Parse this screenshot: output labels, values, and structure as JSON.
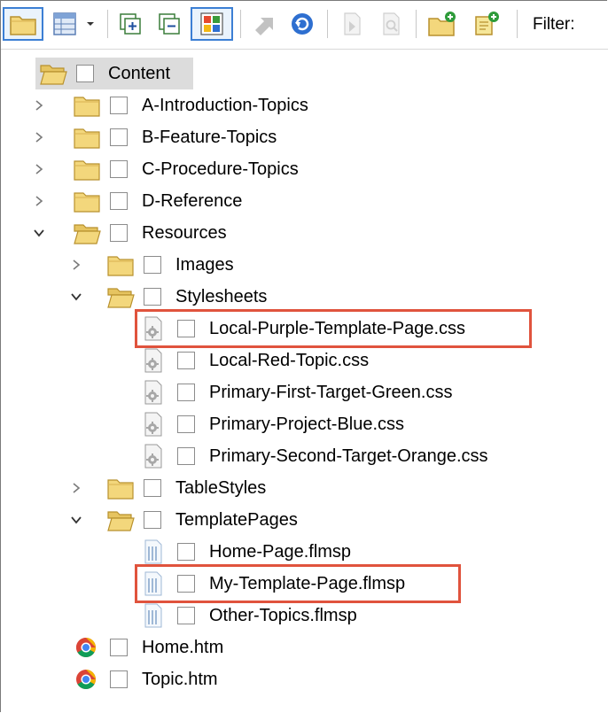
{
  "toolbar": {
    "filter_label": "Filter:"
  },
  "tree": {
    "root": {
      "label": "Content",
      "icon": "folder-open-icon"
    },
    "items": [
      {
        "label": "A-Introduction-Topics",
        "icon": "folder-icon",
        "state": "collapsed"
      },
      {
        "label": "B-Feature-Topics",
        "icon": "folder-icon",
        "state": "collapsed"
      },
      {
        "label": "C-Procedure-Topics",
        "icon": "folder-icon",
        "state": "collapsed"
      },
      {
        "label": "D-Reference",
        "icon": "folder-icon",
        "state": "collapsed"
      },
      {
        "label": "Resources",
        "icon": "folder-open-icon",
        "state": "expanded"
      },
      {
        "label": "Images",
        "icon": "folder-icon",
        "state": "collapsed"
      },
      {
        "label": "Stylesheets",
        "icon": "folder-open-icon",
        "state": "expanded"
      },
      {
        "label": "Local-Purple-Template-Page.css",
        "icon": "stylesheet-file-icon",
        "highlighted": true
      },
      {
        "label": "Local-Red-Topic.css",
        "icon": "stylesheet-file-icon"
      },
      {
        "label": "Primary-First-Target-Green.css",
        "icon": "stylesheet-file-icon"
      },
      {
        "label": "Primary-Project-Blue.css",
        "icon": "stylesheet-file-icon"
      },
      {
        "label": "Primary-Second-Target-Orange.css",
        "icon": "stylesheet-file-icon"
      },
      {
        "label": "TableStyles",
        "icon": "folder-icon",
        "state": "collapsed"
      },
      {
        "label": "TemplatePages",
        "icon": "folder-open-icon",
        "state": "expanded"
      },
      {
        "label": "Home-Page.flmsp",
        "icon": "template-page-file-icon"
      },
      {
        "label": "My-Template-Page.flmsp",
        "icon": "template-page-file-icon",
        "highlighted": true
      },
      {
        "label": "Other-Topics.flmsp",
        "icon": "template-page-file-icon"
      },
      {
        "label": "Home.htm",
        "icon": "chrome-htm-file-icon"
      },
      {
        "label": "Topic.htm",
        "icon": "chrome-htm-file-icon"
      }
    ]
  },
  "colors": {
    "highlight_box": "#e0533d",
    "selected_tool_border": "#3c7fd4",
    "folder": "#f3d77c"
  }
}
